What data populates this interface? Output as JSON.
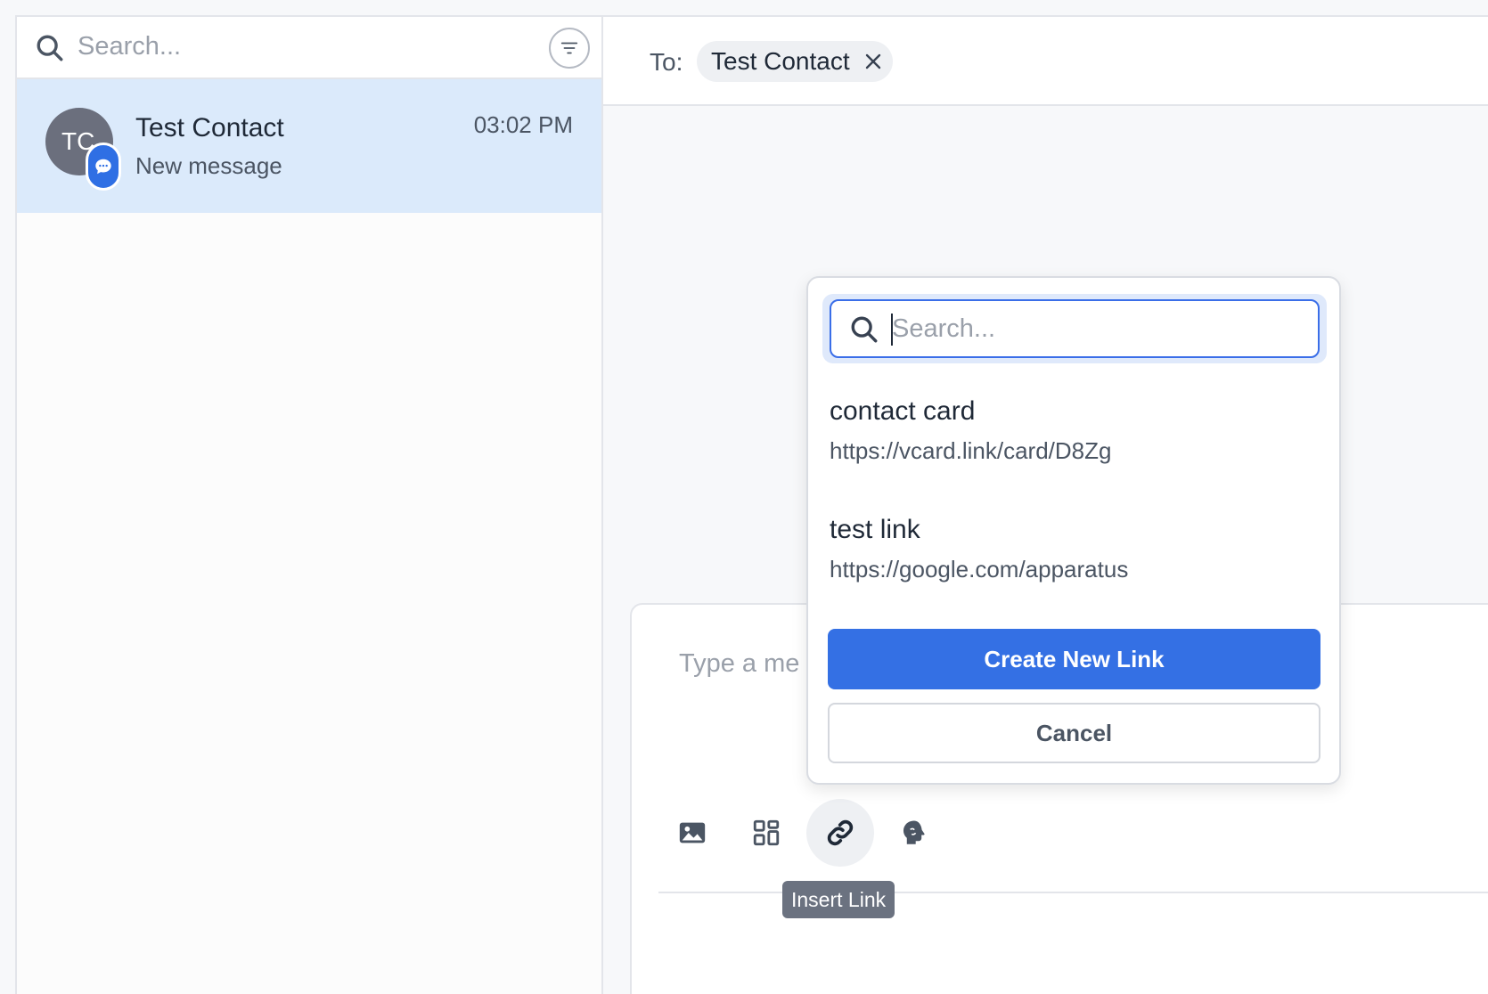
{
  "sidebar": {
    "search": {
      "placeholder": "Search..."
    },
    "filter_icon": "filter-icon",
    "conversations": [
      {
        "initials": "TC",
        "name": "Test Contact",
        "preview": "New message",
        "time": "03:02 PM",
        "channel_icon": "chat-bubble-icon",
        "selected": true
      }
    ]
  },
  "conversation": {
    "to_label": "To:",
    "recipient": "Test Contact",
    "composer_placeholder": "Type a me",
    "toolbar": {
      "icons": [
        "image-icon",
        "apps-icon",
        "link-icon",
        "brain-icon"
      ],
      "active_tooltip": "Insert Link"
    }
  },
  "link_picker": {
    "search_placeholder": "Search...",
    "links": [
      {
        "title": "contact card",
        "url": "https://vcard.link/card/D8Zg"
      },
      {
        "title": "test link",
        "url": "https://google.com/apparatus"
      }
    ],
    "create_label": "Create New Link",
    "cancel_label": "Cancel"
  },
  "colors": {
    "accent": "#3470e4",
    "selected_row": "#dbeafb",
    "avatar": "#6b6f7d",
    "tooltip": "#6b7280"
  }
}
